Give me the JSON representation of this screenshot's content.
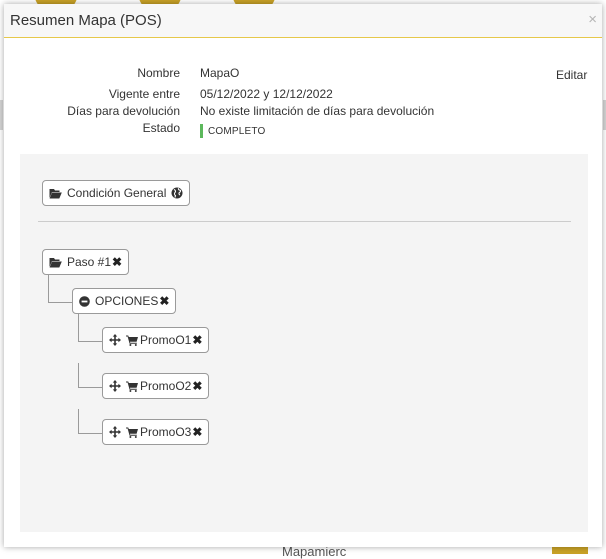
{
  "background": {
    "fragment_text": "Mapamierc"
  },
  "modal": {
    "title": "Resumen Mapa (POS)",
    "close_glyph": "×",
    "edit_label": "Editar",
    "info": {
      "nombre_label": "Nombre",
      "nombre_value": "MapaO",
      "vigente_label": "Vigente entre",
      "vigente_value": "05/12/2022 y 12/12/2022",
      "dias_label": "Días para devolución",
      "dias_value": "No existe limitación de días para devolución",
      "estado_label": "Estado",
      "estado_value": "COMPLETO"
    }
  },
  "tree": {
    "general": {
      "label": "Condición General",
      "icon": "folder-open-icon",
      "extra_icon": "globe-icon"
    },
    "step": {
      "label": "Paso #1",
      "icon": "folder-open-icon"
    },
    "options": {
      "label": "OPCIONES",
      "icon": "minus-circle-icon"
    },
    "promos": [
      {
        "label": "PromoO1"
      },
      {
        "label": "PromoO2"
      },
      {
        "label": "PromoO3"
      }
    ],
    "remove_glyph": "✖"
  },
  "colors": {
    "header_border": "#e6c84a",
    "status_bar": "#5cb85c",
    "canvas_bg": "#f4f4f4"
  }
}
